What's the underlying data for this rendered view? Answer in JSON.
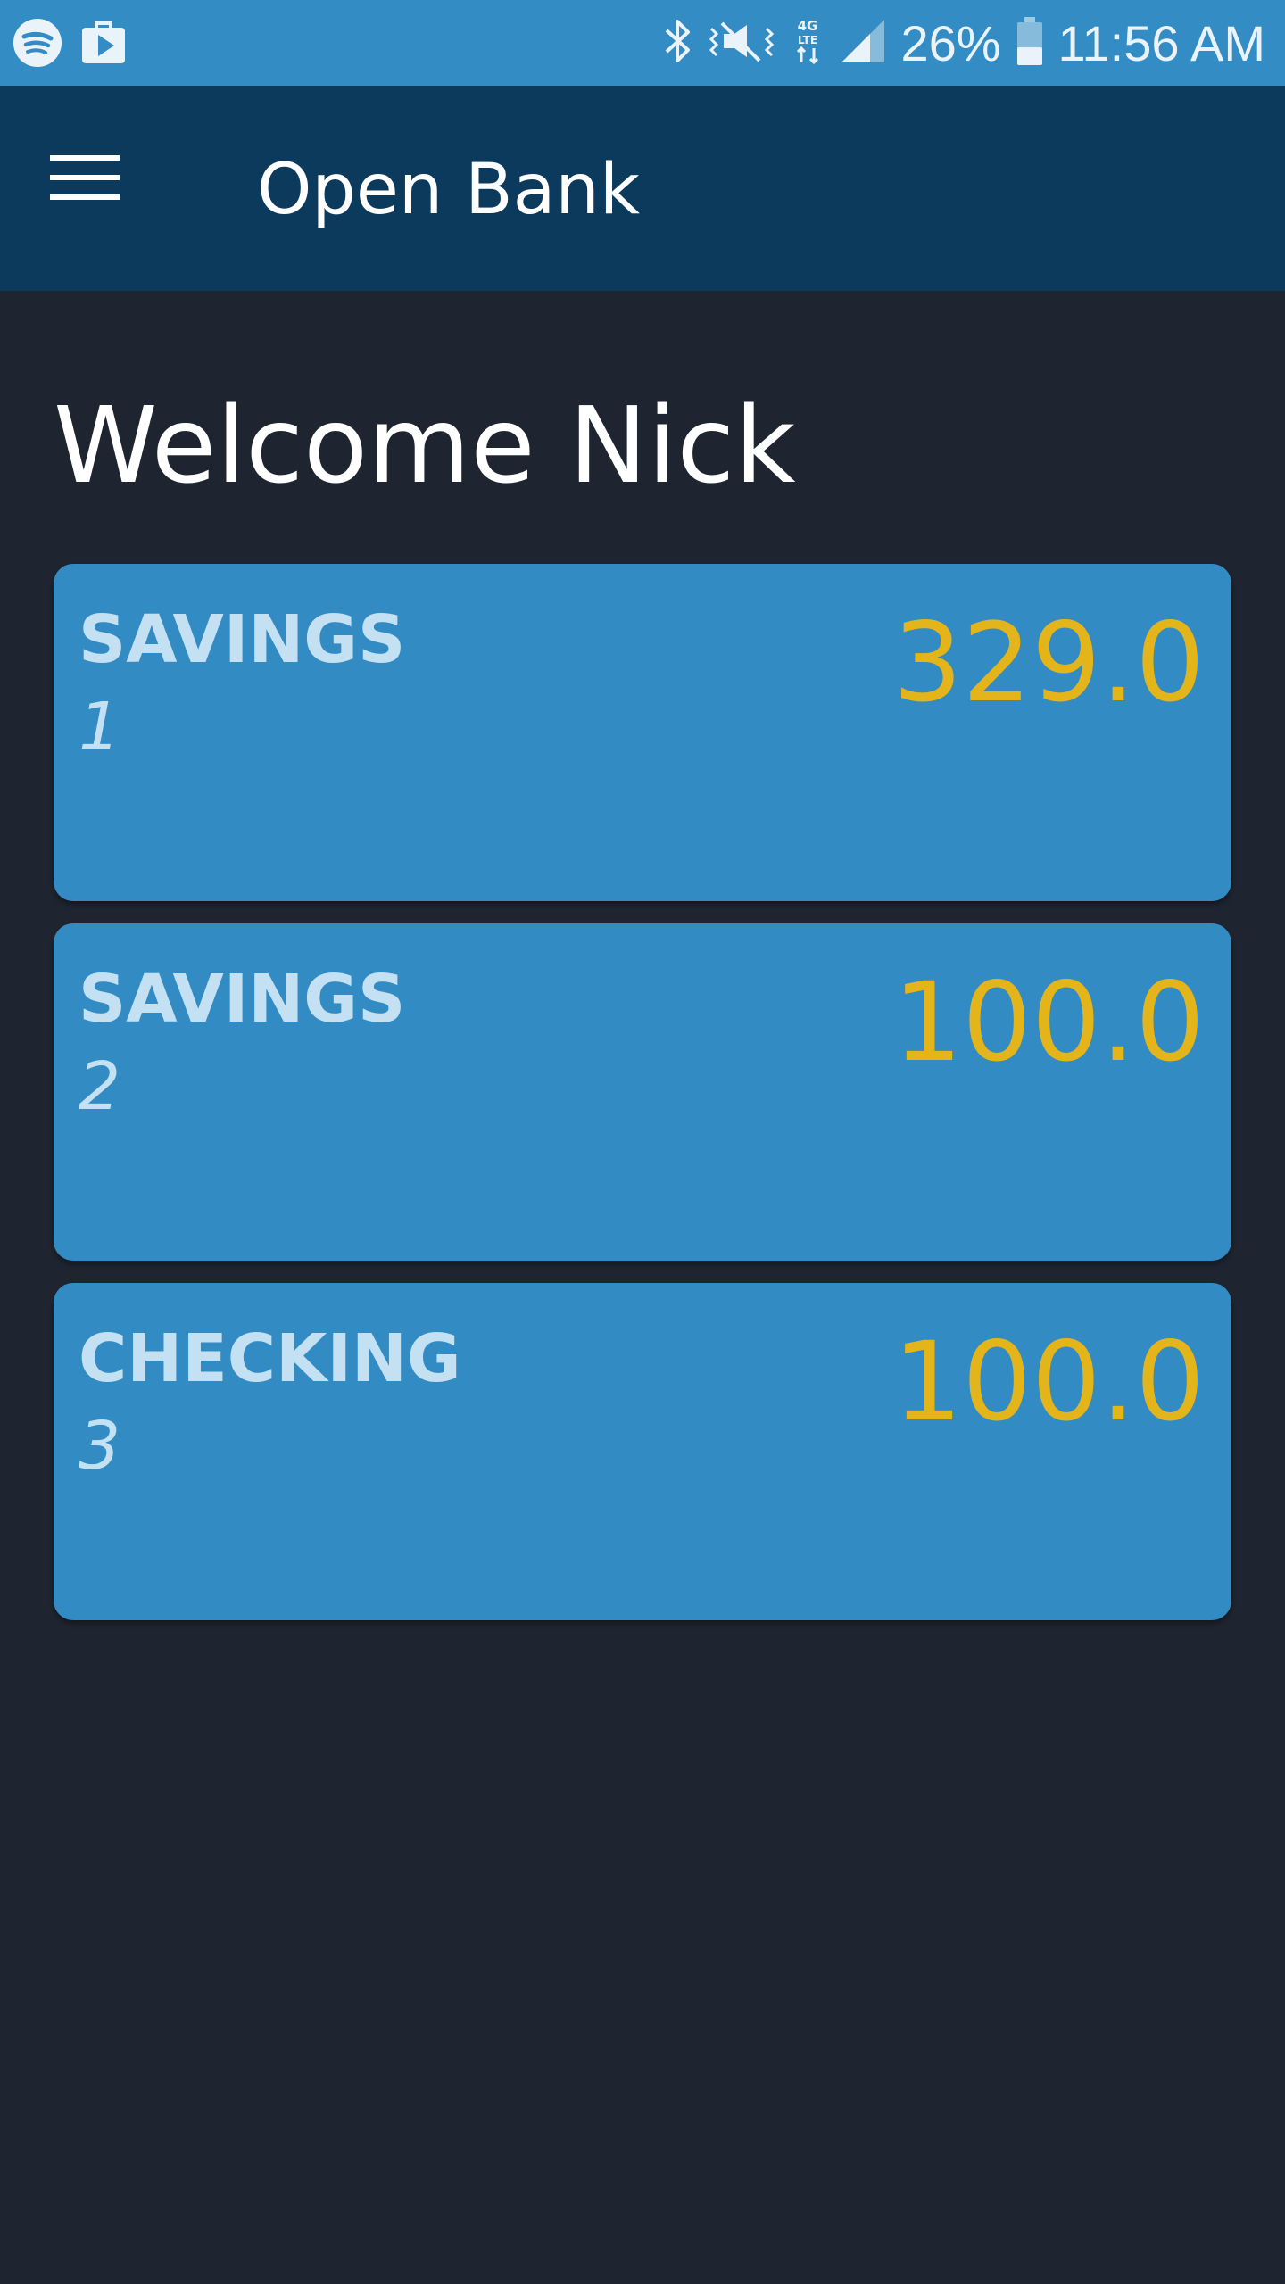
{
  "status_bar": {
    "battery": "26%",
    "time": "11:56 AM",
    "network": "4G LTE",
    "left_icons": [
      "spotify-icon",
      "play-store-icon"
    ],
    "right_icons": [
      "bluetooth-icon",
      "vibrate-icon",
      "lte-icon",
      "signal-icon",
      "battery-icon"
    ]
  },
  "app_bar": {
    "title": "Open Bank",
    "menu_icon": "menu-icon"
  },
  "main": {
    "welcome": "Welcome Nick",
    "accounts": [
      {
        "type": "SAVINGS",
        "number": "1",
        "balance": "329.0"
      },
      {
        "type": "SAVINGS",
        "number": "2",
        "balance": "100.0"
      },
      {
        "type": "CHECKING",
        "number": "3",
        "balance": "100.0"
      }
    ]
  },
  "colors": {
    "status_bar": "#338cc3",
    "app_bar": "#0b3a5d",
    "background": "#1e2530",
    "card": "#338bc3",
    "card_label": "#c4e0f3",
    "balance": "#e4b51a"
  }
}
